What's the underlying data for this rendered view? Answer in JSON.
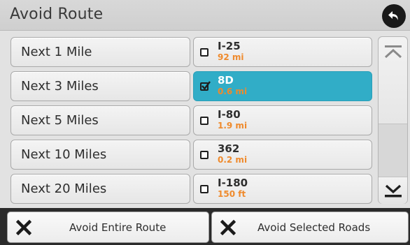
{
  "header": {
    "title": "Avoid Route",
    "back_icon": "back-arrow-icon"
  },
  "distances": [
    {
      "label": "Next 1 Mile"
    },
    {
      "label": "Next 3 Miles"
    },
    {
      "label": "Next 5 Miles"
    },
    {
      "label": "Next 10 Miles"
    },
    {
      "label": "Next 20 Miles"
    }
  ],
  "roads": [
    {
      "name": "I-25",
      "distance": "92 mi",
      "checked": false
    },
    {
      "name": "8D",
      "distance": "0.6 mi",
      "checked": true
    },
    {
      "name": "I-80",
      "distance": "1.9 mi",
      "checked": false
    },
    {
      "name": "362",
      "distance": "0.2 mi",
      "checked": false
    },
    {
      "name": "I-180",
      "distance": "150 ft",
      "checked": false
    }
  ],
  "footer": {
    "avoid_entire_label": "Avoid Entire Route",
    "avoid_selected_label": "Avoid Selected Roads"
  },
  "colors": {
    "selected_bg": "#31adc7",
    "distance_text": "#ef8a2c",
    "footer_bg": "#2b2b2b"
  }
}
